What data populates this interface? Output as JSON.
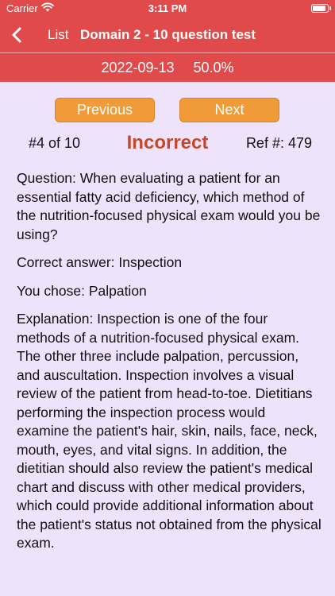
{
  "status_bar": {
    "carrier": "Carrier",
    "time": "3:11 PM"
  },
  "nav": {
    "back_label": "List",
    "title": "Domain 2 - 10 question test"
  },
  "subheader": {
    "date": "2022-09-13",
    "score": "50.0%"
  },
  "buttons": {
    "previous": "Previous",
    "next": "Next"
  },
  "question_info": {
    "index": "#4 of 10",
    "result": "Incorrect",
    "ref": "Ref #: 479"
  },
  "content": {
    "question": "Question:  When evaluating a patient for an essential fatty acid deficiency, which method of the nutrition-focused physical exam would you be using?",
    "correct_answer": "Correct answer: Inspection",
    "user_choice": "You chose: Palpation",
    "explanation": "Explanation:  Inspection is one of the four methods of a nutrition-focused physical exam.  The other three include palpation, percussion, and auscultation.  Inspection involves a visual review of the patient from head-to-toe.  Dietitians performing the inspection process would examine the patient's hair, skin, nails, face, neck, mouth, eyes, and vital signs.  In addition, the dietitian should also review the patient's medical chart and discuss with other medical providers, which could provide additional information about the patient's status not obtained from the physical exam."
  },
  "icons": {
    "wifi": "wifi-icon",
    "battery": "battery-icon",
    "back": "chevron-left-icon"
  },
  "colors": {
    "header": "#e14a4a",
    "background": "#efe2fb",
    "button": "#f09b38",
    "incorrect": "#c14a2b"
  }
}
